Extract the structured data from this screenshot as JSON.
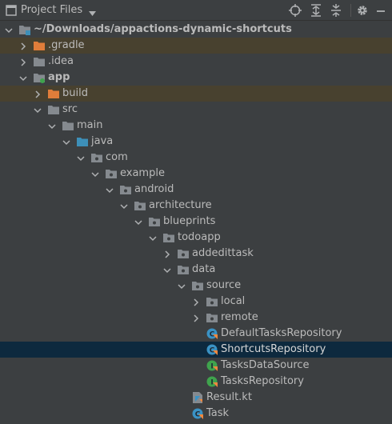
{
  "header": {
    "title": "Project Files",
    "icons": [
      "locate-icon",
      "expand-all-icon",
      "collapse-all-icon",
      "settings-icon",
      "hide-icon"
    ]
  },
  "colors": {
    "background": "#3c3f41",
    "selected_row": "#0d293e",
    "excluded_row": "#48412f",
    "folder": "#858a8f",
    "excluded_folder": "#e07d3a",
    "source_folder": "#3d8fb8",
    "class_icon": "#3a92c4",
    "interface_icon": "#3fa34d",
    "kotlin_accent": "#f0883e"
  },
  "tree": [
    {
      "label": "~/Downloads/appactions-dynamic-shortcuts",
      "depth": 0,
      "expanded": true,
      "icon": "project-folder-icon",
      "bold": true
    },
    {
      "label": ".gradle",
      "depth": 1,
      "expanded": false,
      "icon": "excluded-folder-icon",
      "highlight": "orange"
    },
    {
      "label": ".idea",
      "depth": 1,
      "expanded": false,
      "icon": "folder-icon"
    },
    {
      "label": "app",
      "depth": 1,
      "expanded": true,
      "icon": "module-folder-icon",
      "bold": true
    },
    {
      "label": "build",
      "depth": 2,
      "expanded": false,
      "icon": "excluded-folder-icon",
      "highlight": "orange"
    },
    {
      "label": "src",
      "depth": 2,
      "expanded": true,
      "icon": "folder-icon"
    },
    {
      "label": "main",
      "depth": 3,
      "expanded": true,
      "icon": "folder-icon"
    },
    {
      "label": "java",
      "depth": 4,
      "expanded": true,
      "icon": "source-folder-icon"
    },
    {
      "label": "com",
      "depth": 5,
      "expanded": true,
      "icon": "package-icon"
    },
    {
      "label": "example",
      "depth": 6,
      "expanded": true,
      "icon": "package-icon"
    },
    {
      "label": "android",
      "depth": 7,
      "expanded": true,
      "icon": "package-icon"
    },
    {
      "label": "architecture",
      "depth": 8,
      "expanded": true,
      "icon": "package-icon"
    },
    {
      "label": "blueprints",
      "depth": 9,
      "expanded": true,
      "icon": "package-icon"
    },
    {
      "label": "todoapp",
      "depth": 10,
      "expanded": true,
      "icon": "package-icon"
    },
    {
      "label": "addedittask",
      "depth": 11,
      "expanded": false,
      "icon": "package-icon"
    },
    {
      "label": "data",
      "depth": 11,
      "expanded": true,
      "icon": "package-icon"
    },
    {
      "label": "source",
      "depth": 12,
      "expanded": true,
      "icon": "package-icon"
    },
    {
      "label": "local",
      "depth": 13,
      "expanded": false,
      "icon": "package-icon"
    },
    {
      "label": "remote",
      "depth": 13,
      "expanded": false,
      "icon": "package-icon"
    },
    {
      "label": "DefaultTasksRepository",
      "depth": 13,
      "icon": "kotlin-class-icon"
    },
    {
      "label": "ShortcutsRepository",
      "depth": 13,
      "icon": "kotlin-class-icon",
      "selected": true
    },
    {
      "label": "TasksDataSource",
      "depth": 13,
      "icon": "kotlin-interface-icon"
    },
    {
      "label": "TasksRepository",
      "depth": 13,
      "icon": "kotlin-interface-icon"
    },
    {
      "label": "Result.kt",
      "depth": 12,
      "icon": "kotlin-file-icon"
    },
    {
      "label": "Task",
      "depth": 12,
      "icon": "kotlin-class-icon"
    }
  ]
}
